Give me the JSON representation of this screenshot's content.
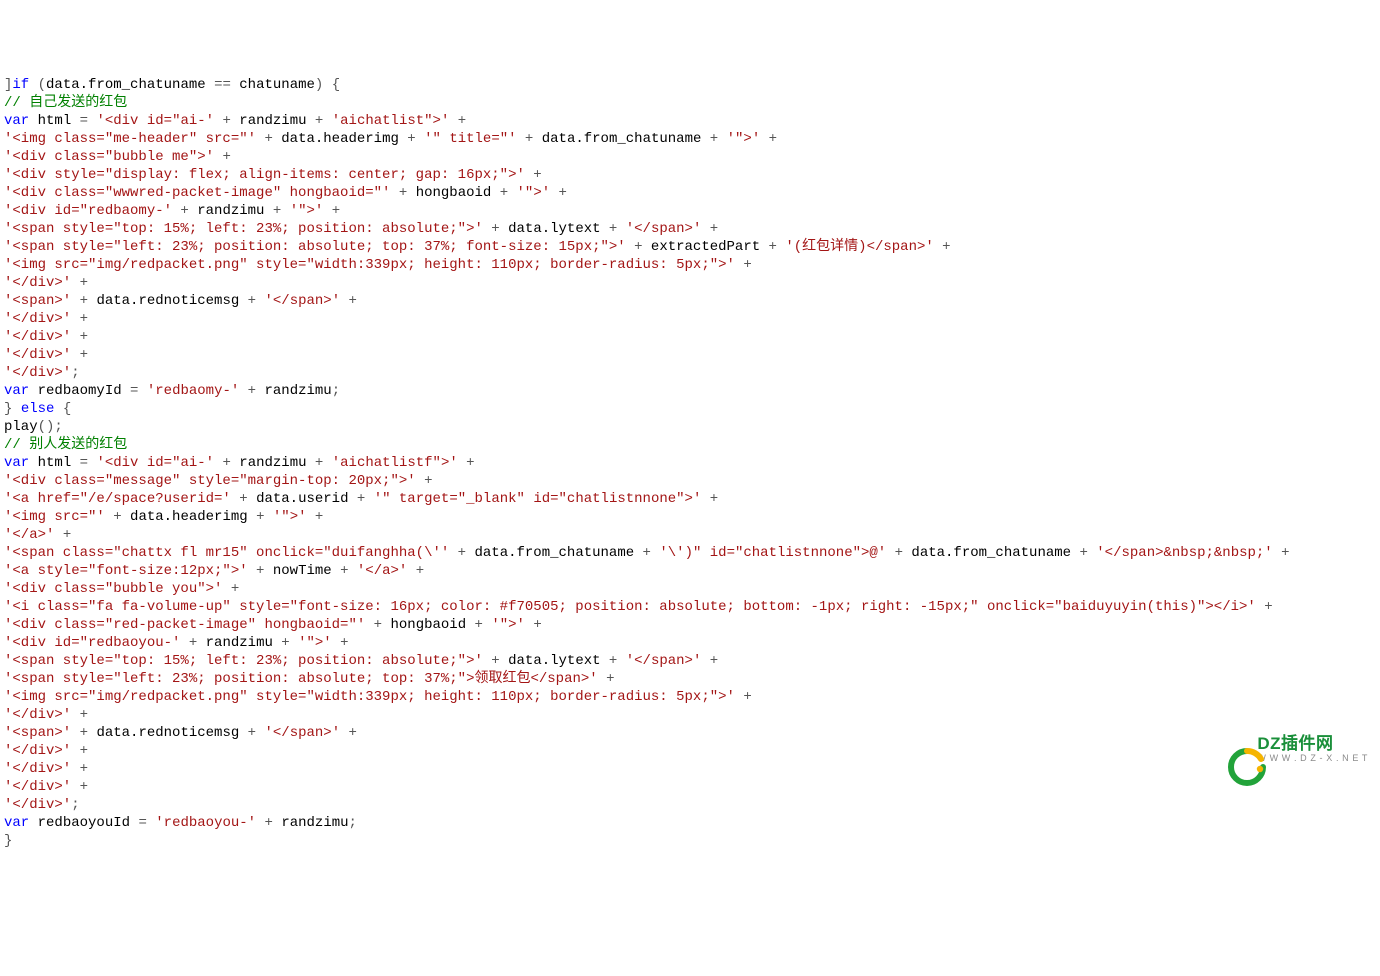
{
  "lines": [
    [
      [
        "pn",
        "]"
      ],
      [
        "kw",
        "if"
      ],
      [
        "pn",
        " ("
      ],
      [
        "id",
        "data.from_chatuname"
      ],
      [
        "pn",
        " == "
      ],
      [
        "id",
        "chatuname"
      ],
      [
        "pn",
        ") {"
      ]
    ],
    [
      [
        "cm",
        "// 自己发送的红包"
      ]
    ],
    [
      [
        "kw",
        "var"
      ],
      [
        "pn",
        " "
      ],
      [
        "id",
        "html"
      ],
      [
        "pn",
        " = "
      ],
      [
        "str",
        "'<div id=\"ai-'"
      ],
      [
        "pn",
        " + "
      ],
      [
        "id",
        "randzimu"
      ],
      [
        "pn",
        " + "
      ],
      [
        "str",
        "'aichatlist\">'"
      ],
      [
        "pn",
        " +"
      ]
    ],
    [
      [
        "str",
        "'<img class=\"me-header\" src=\"'"
      ],
      [
        "pn",
        " + "
      ],
      [
        "id",
        "data.headerimg"
      ],
      [
        "pn",
        " + "
      ],
      [
        "str",
        "'\" title=\"'"
      ],
      [
        "pn",
        " + "
      ],
      [
        "id",
        "data.from_chatuname"
      ],
      [
        "pn",
        " + "
      ],
      [
        "str",
        "'\">'"
      ],
      [
        "pn",
        " +"
      ]
    ],
    [
      [
        "str",
        "'<div class=\"bubble me\">'"
      ],
      [
        "pn",
        " +"
      ]
    ],
    [
      [
        "str",
        "'<div style=\"display: flex; align-items: center; gap: 16px;\">'"
      ],
      [
        "pn",
        " +"
      ]
    ],
    [
      [
        "str",
        "'<div class=\"wwwred-packet-image\" hongbaoid=\"'"
      ],
      [
        "pn",
        " + "
      ],
      [
        "id",
        "hongbaoid"
      ],
      [
        "pn",
        " + "
      ],
      [
        "str",
        "'\">'"
      ],
      [
        "pn",
        " +"
      ]
    ],
    [
      [
        "str",
        "'<div id=\"redbaomy-'"
      ],
      [
        "pn",
        " + "
      ],
      [
        "id",
        "randzimu"
      ],
      [
        "pn",
        " + "
      ],
      [
        "str",
        "'\">'"
      ],
      [
        "pn",
        " +"
      ]
    ],
    [
      [
        "str",
        "'<span style=\"top: 15%; left: 23%; position: absolute;\">'"
      ],
      [
        "pn",
        " + "
      ],
      [
        "id",
        "data.lytext"
      ],
      [
        "pn",
        " + "
      ],
      [
        "str",
        "'</span>'"
      ],
      [
        "pn",
        " +"
      ]
    ],
    [
      [
        "str",
        "'<span style=\"left: 23%; position: absolute; top: 37%; font-size: 15px;\">'"
      ],
      [
        "pn",
        " + "
      ],
      [
        "id",
        "extractedPart"
      ],
      [
        "pn",
        " + "
      ],
      [
        "str",
        "'(红包详情)</span>'"
      ],
      [
        "pn",
        " +"
      ]
    ],
    [
      [
        "str",
        "'<img src=\"img/redpacket.png\" style=\"width:339px; height: 110px; border-radius: 5px;\">'"
      ],
      [
        "pn",
        " +"
      ]
    ],
    [
      [
        "str",
        "'</div>'"
      ],
      [
        "pn",
        " +"
      ]
    ],
    [
      [
        "str",
        "'<span>'"
      ],
      [
        "pn",
        " + "
      ],
      [
        "id",
        "data.rednoticemsg"
      ],
      [
        "pn",
        " + "
      ],
      [
        "str",
        "'</span>'"
      ],
      [
        "pn",
        " +"
      ]
    ],
    [
      [
        "str",
        "'</div>'"
      ],
      [
        "pn",
        " +"
      ]
    ],
    [
      [
        "str",
        "'</div>'"
      ],
      [
        "pn",
        " +"
      ]
    ],
    [
      [
        "str",
        "'</div>'"
      ],
      [
        "pn",
        " +"
      ]
    ],
    [
      [
        "str",
        "'</div>'"
      ],
      [
        "pn",
        ";"
      ]
    ],
    [
      [
        "kw",
        "var"
      ],
      [
        "pn",
        " "
      ],
      [
        "id",
        "redbaomyId"
      ],
      [
        "pn",
        " = "
      ],
      [
        "str",
        "'redbaomy-'"
      ],
      [
        "pn",
        " + "
      ],
      [
        "id",
        "randzimu"
      ],
      [
        "pn",
        ";"
      ]
    ],
    [
      [
        "pn",
        "} "
      ],
      [
        "kw",
        "else"
      ],
      [
        "pn",
        " {"
      ]
    ],
    [
      [
        "id",
        "play"
      ],
      [
        "pn",
        "();"
      ]
    ],
    [
      [
        "cm",
        "// 别人发送的红包"
      ]
    ],
    [
      [
        "kw",
        "var"
      ],
      [
        "pn",
        " "
      ],
      [
        "id",
        "html"
      ],
      [
        "pn",
        " = "
      ],
      [
        "str",
        "'<div id=\"ai-'"
      ],
      [
        "pn",
        " + "
      ],
      [
        "id",
        "randzimu"
      ],
      [
        "pn",
        " + "
      ],
      [
        "str",
        "'aichatlistf\">'"
      ],
      [
        "pn",
        " +"
      ]
    ],
    [
      [
        "str",
        "'<div class=\"message\" style=\"margin-top: 20px;\">'"
      ],
      [
        "pn",
        " +"
      ]
    ],
    [
      [
        "str",
        "'<a href=\"/e/space?userid='"
      ],
      [
        "pn",
        " + "
      ],
      [
        "id",
        "data.userid"
      ],
      [
        "pn",
        " + "
      ],
      [
        "str",
        "'\" target=\"_blank\" id=\"chatlistnnone\">'"
      ],
      [
        "pn",
        " +"
      ]
    ],
    [
      [
        "str",
        "'<img src=\"'"
      ],
      [
        "pn",
        " + "
      ],
      [
        "id",
        "data.headerimg"
      ],
      [
        "pn",
        " + "
      ],
      [
        "str",
        "'\">'"
      ],
      [
        "pn",
        " +"
      ]
    ],
    [
      [
        "str",
        "'</a>'"
      ],
      [
        "pn",
        " +"
      ]
    ],
    [
      [
        "str",
        "'<span class=\"chattx fl mr15\" onclick=\"duifanghha(\\''"
      ],
      [
        "pn",
        " + "
      ],
      [
        "id",
        "data.from_chatuname"
      ],
      [
        "pn",
        " + "
      ],
      [
        "str",
        "'\\')\" id=\"chatlistnnone\">@'"
      ],
      [
        "pn",
        " + "
      ],
      [
        "id",
        "data.from_chatuname"
      ],
      [
        "pn",
        " + "
      ],
      [
        "str",
        "'</span>&nbsp;&nbsp;'"
      ],
      [
        "pn",
        " +"
      ]
    ],
    [
      [
        "str",
        "'<a style=\"font-size:12px;\">'"
      ],
      [
        "pn",
        " + "
      ],
      [
        "id",
        "nowTime"
      ],
      [
        "pn",
        " + "
      ],
      [
        "str",
        "'</a>'"
      ],
      [
        "pn",
        " +"
      ]
    ],
    [
      [
        "str",
        "'<div class=\"bubble you\">'"
      ],
      [
        "pn",
        " +"
      ]
    ],
    [
      [
        "str",
        "'<i class=\"fa fa-volume-up\" style=\"font-size: 16px; color: #f70505; position: absolute; bottom: -1px; right: -15px;\" onclick=\"baiduyuyin(this)\"></i>'"
      ],
      [
        "pn",
        " +"
      ]
    ],
    [
      [
        "str",
        "'<div class=\"red-packet-image\" hongbaoid=\"'"
      ],
      [
        "pn",
        " + "
      ],
      [
        "id",
        "hongbaoid"
      ],
      [
        "pn",
        " + "
      ],
      [
        "str",
        "'\">'"
      ],
      [
        "pn",
        " +"
      ]
    ],
    [
      [
        "str",
        "'<div id=\"redbaoyou-'"
      ],
      [
        "pn",
        " + "
      ],
      [
        "id",
        "randzimu"
      ],
      [
        "pn",
        " + "
      ],
      [
        "str",
        "'\">'"
      ],
      [
        "pn",
        " +"
      ]
    ],
    [
      [
        "str",
        "'<span style=\"top: 15%; left: 23%; position: absolute;\">'"
      ],
      [
        "pn",
        " + "
      ],
      [
        "id",
        "data.lytext"
      ],
      [
        "pn",
        " + "
      ],
      [
        "str",
        "'</span>'"
      ],
      [
        "pn",
        " +"
      ]
    ],
    [
      [
        "str",
        "'<span style=\"left: 23%; position: absolute; top: 37%;\">领取红包</span>'"
      ],
      [
        "pn",
        " +"
      ]
    ],
    [
      [
        "str",
        "'<img src=\"img/redpacket.png\" style=\"width:339px; height: 110px; border-radius: 5px;\">'"
      ],
      [
        "pn",
        " +"
      ]
    ],
    [
      [
        "str",
        "'</div>'"
      ],
      [
        "pn",
        " +"
      ]
    ],
    [
      [
        "str",
        "'<span>'"
      ],
      [
        "pn",
        " + "
      ],
      [
        "id",
        "data.rednoticemsg"
      ],
      [
        "pn",
        " + "
      ],
      [
        "str",
        "'</span>'"
      ],
      [
        "pn",
        " +"
      ]
    ],
    [
      [
        "str",
        "'</div>'"
      ],
      [
        "pn",
        " +"
      ]
    ],
    [
      [
        "str",
        "'</div>'"
      ],
      [
        "pn",
        " +"
      ]
    ],
    [
      [
        "str",
        "'</div>'"
      ],
      [
        "pn",
        " +"
      ]
    ],
    [
      [
        "str",
        "'</div>'"
      ],
      [
        "pn",
        ";"
      ]
    ],
    [
      [
        "kw",
        "var"
      ],
      [
        "pn",
        " "
      ],
      [
        "id",
        "redbaoyouId"
      ],
      [
        "pn",
        " = "
      ],
      [
        "str",
        "'redbaoyou-'"
      ],
      [
        "pn",
        " + "
      ],
      [
        "id",
        "randzimu"
      ],
      [
        "pn",
        ";"
      ]
    ],
    [
      [
        "pn",
        "}"
      ]
    ]
  ],
  "watermark": {
    "line1": "DZ插件网",
    "line2": "W W W . D Z - X . N E T"
  }
}
